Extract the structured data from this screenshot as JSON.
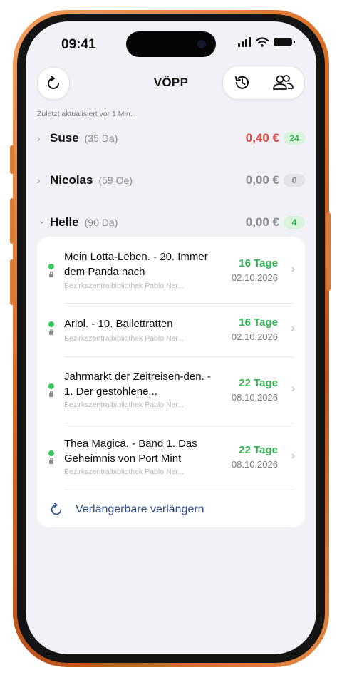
{
  "status_bar": {
    "time": "09:41"
  },
  "header": {
    "title": "VÖPP"
  },
  "last_updated": "Zuletzt aktualisiert vor 1 Min.",
  "groups": [
    {
      "name": "Suse",
      "sub": "(35 Da)",
      "amount": "0,40 €",
      "count": "24",
      "expanded": false
    },
    {
      "name": "Nicolas",
      "sub": "(59 Oe)",
      "amount": "0,00 €",
      "count": "0",
      "expanded": false
    },
    {
      "name": "Helle",
      "sub": "(90 Da)",
      "amount": "0,00 €",
      "count": "4",
      "expanded": true
    }
  ],
  "items": [
    {
      "title": "Mein Lotta-Leben. - 20. Immer dem Panda nach",
      "library": "Bezirkszentralbibliothek Pablo Ner...",
      "days": "16 Tage",
      "date": "02.10.2026"
    },
    {
      "title": "Ariol. - 10. Ballettratten",
      "library": "Bezirkszentralbibliothek Pablo Ner...",
      "days": "16 Tage",
      "date": "02.10.2026"
    },
    {
      "title": "Jahrmarkt der Zeitreisen-den. - 1. Der gestohlene...",
      "library": "Bezirkszentralbibliothek Pablo Ner...",
      "days": "22 Tage",
      "date": "08.10.2026"
    },
    {
      "title": "Thea Magica. - Band 1. Das Geheimnis von Port Mint",
      "library": "Bezirkszentralbibliothek Pablo Ner...",
      "days": "22 Tage",
      "date": "08.10.2026"
    }
  ],
  "extend_action": "Verlängerbare verlängern",
  "colors": {
    "accent": "#2f4d8a",
    "green": "#34b152",
    "red": "#e5443a",
    "background": "#f2f1f8"
  }
}
